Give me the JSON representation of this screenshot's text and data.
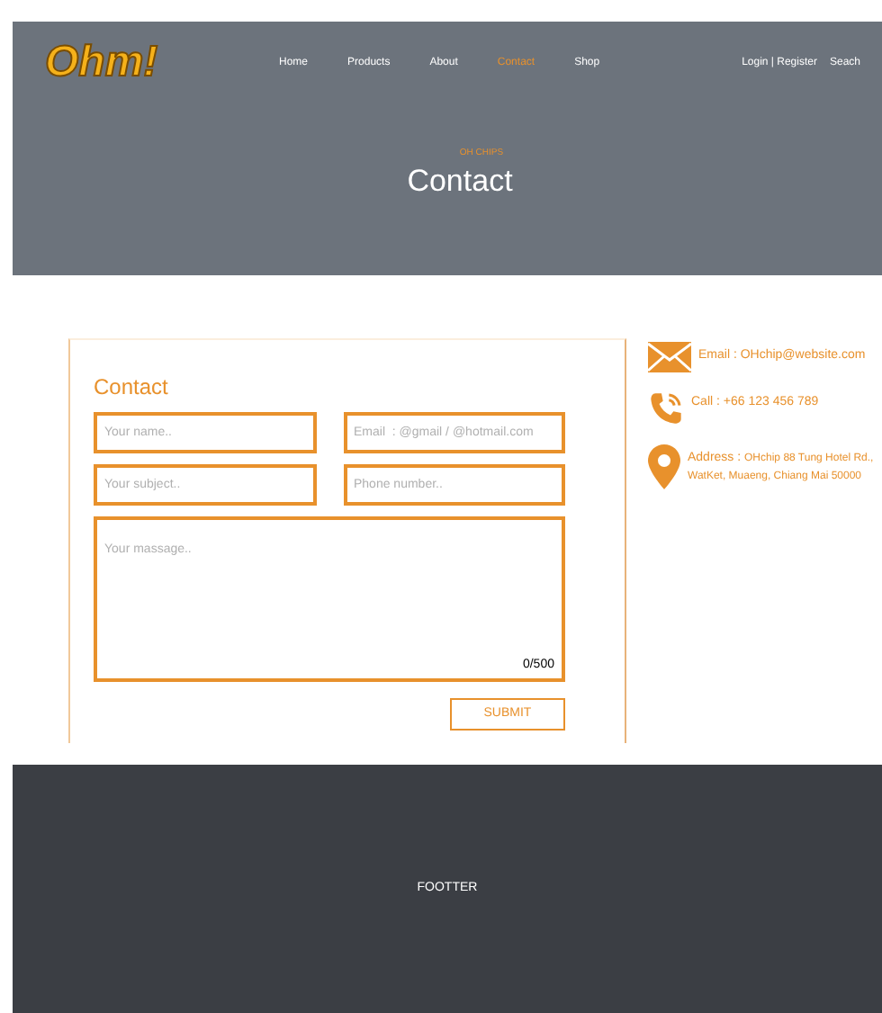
{
  "header": {
    "logo": "Ohm!",
    "nav": [
      {
        "label": "Home",
        "selected": false
      },
      {
        "label": "Products",
        "selected": false
      },
      {
        "label": "About",
        "selected": false
      },
      {
        "label": "Contact",
        "selected": true
      },
      {
        "label": "Shop",
        "selected": false
      }
    ],
    "login": "Login | Register",
    "search": "Seach"
  },
  "hero": {
    "eyebrow": "OH CHIPS",
    "title": "Contact"
  },
  "form": {
    "title": "Contact",
    "name_placeholder": "Your name..",
    "email_placeholder": "Email  : @gmail / @hotmail.com",
    "subject_placeholder": "Your subject..",
    "phone_placeholder": "Phone number..",
    "message_placeholder": "Your massage..",
    "counter": "0/500",
    "submit": "SUBMIT"
  },
  "info": [
    {
      "kind": "email",
      "label": "Email : ",
      "value": "OHchip@website.com"
    },
    {
      "kind": "phone",
      "label": "Call : ",
      "value": "+66 123 456 789"
    },
    {
      "kind": "address",
      "label": "Address : ",
      "value": "OHchip 88 Tung Hotel Rd., WatKet, Muaeng, Chiang Mai 50000"
    }
  ],
  "footer": {
    "text": "FOOTTER"
  }
}
